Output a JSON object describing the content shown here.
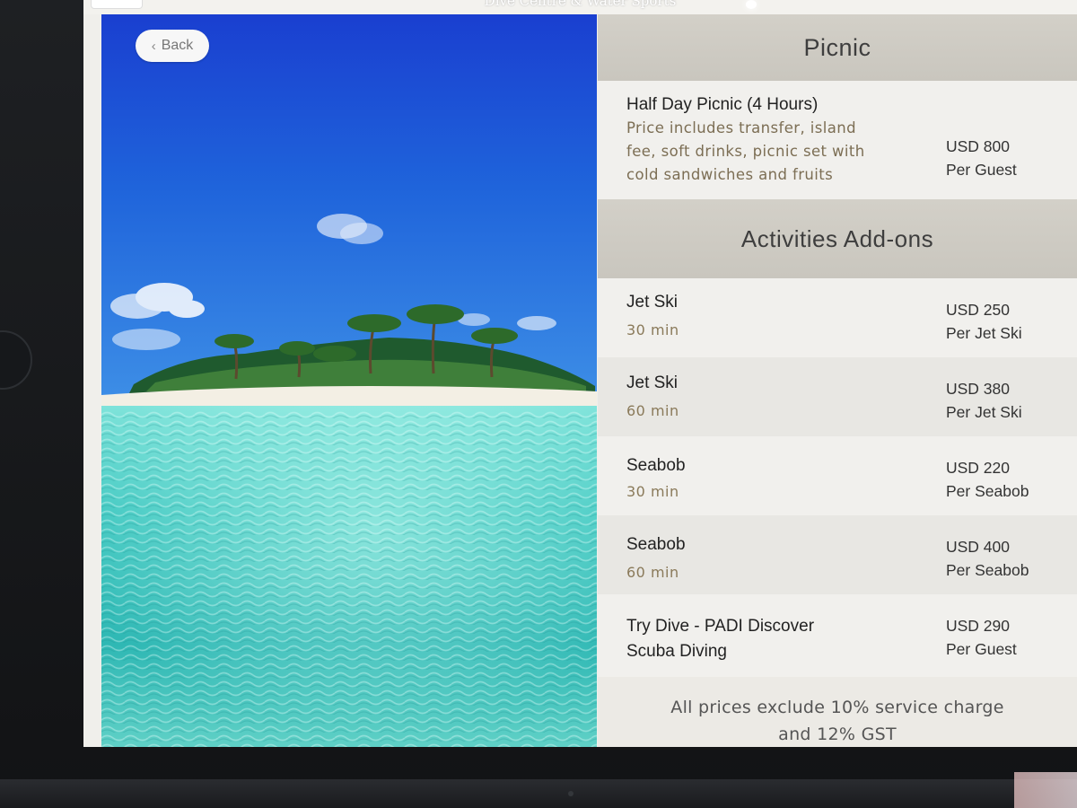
{
  "topbar": {
    "title": "Dive Centre & Water Sports"
  },
  "nav": {
    "back_label": "Back"
  },
  "picnic": {
    "heading": "Picnic",
    "item": {
      "name": "Half Day Picnic (4 Hours)",
      "desc_lines": [
        "Price includes transfer, island",
        "fee, soft drinks, picnic set with",
        "cold sandwiches and fruits"
      ],
      "price": "USD 800",
      "unit": "Per Guest"
    }
  },
  "addons": {
    "heading": "Activities Add-ons",
    "items": [
      {
        "name": "Jet Ski",
        "duration": "30 min",
        "price": "USD 250",
        "unit": "Per Jet Ski"
      },
      {
        "name": "Jet Ski",
        "duration": "60 min",
        "price": "USD 380",
        "unit": "Per Jet Ski"
      },
      {
        "name": "Seabob",
        "duration": "30 min",
        "price": "USD 220",
        "unit": "Per Seabob"
      },
      {
        "name": "Seabob",
        "duration": "60 min",
        "price": "USD 400",
        "unit": "Per Seabob"
      },
      {
        "name_lines": [
          "Try Dive - PADI Discover",
          "Scuba Diving"
        ],
        "price": "USD 290",
        "unit": "Per Guest"
      }
    ]
  },
  "footnote": {
    "lines": [
      "All prices exclude 10% service charge",
      "and 12% GST"
    ]
  },
  "icons": {
    "back": "chevron-left-icon"
  },
  "colors": {
    "sky": "#1f5fd6",
    "water": "#5fd6cf",
    "header_band": "#cfccc4",
    "sub_text": "#8a7a5a"
  }
}
